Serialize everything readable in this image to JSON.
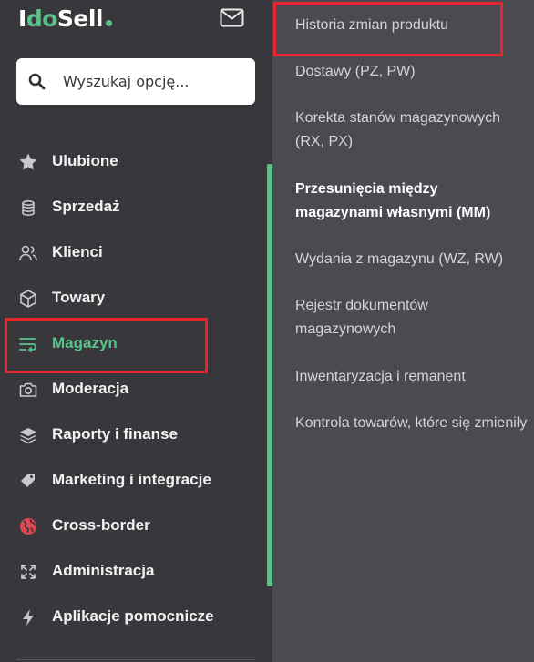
{
  "brand": {
    "logo_i": "I",
    "logo_do": "do",
    "logo_sell": "Sell"
  },
  "search": {
    "placeholder": "Wyszukaj opcję..."
  },
  "sidebar": {
    "items": [
      {
        "label": "Ulubione",
        "icon": "star-icon"
      },
      {
        "label": "Sprzedaż",
        "icon": "coins-icon"
      },
      {
        "label": "Klienci",
        "icon": "users-icon"
      },
      {
        "label": "Towary",
        "icon": "box-icon"
      },
      {
        "label": "Magazyn",
        "icon": "warehouse-icon",
        "active": true
      },
      {
        "label": "Moderacja",
        "icon": "camera-icon"
      },
      {
        "label": "Raporty i finanse",
        "icon": "layers-icon"
      },
      {
        "label": "Marketing i integracje",
        "icon": "tag-icon"
      },
      {
        "label": "Cross-border",
        "icon": "globe-icon"
      },
      {
        "label": "Administracja",
        "icon": "expand-icon"
      },
      {
        "label": "Aplikacje pomocnicze",
        "icon": "bolt-icon"
      }
    ]
  },
  "submenu": {
    "items": [
      {
        "label": "Historia zmian produktu"
      },
      {
        "label": "Dostawy (PZ, PW)"
      },
      {
        "label": "Korekta stanów magazynowych (RX, PX)"
      },
      {
        "label": "Przesunięcia między magazynami własnymi (MM)",
        "bold": true
      },
      {
        "label": "Wydania z magazynu (WZ, RW)"
      },
      {
        "label": "Rejestr dokumentów magazynowych"
      },
      {
        "label": "Inwentaryzacja i remanent"
      },
      {
        "label": "Kontrola towarów, które się zmieniły"
      }
    ]
  },
  "colors": {
    "accent": "#5ac389",
    "highlight": "#e5262c",
    "sidebar_bg": "#38383c",
    "submenu_bg": "#4a4a50"
  }
}
